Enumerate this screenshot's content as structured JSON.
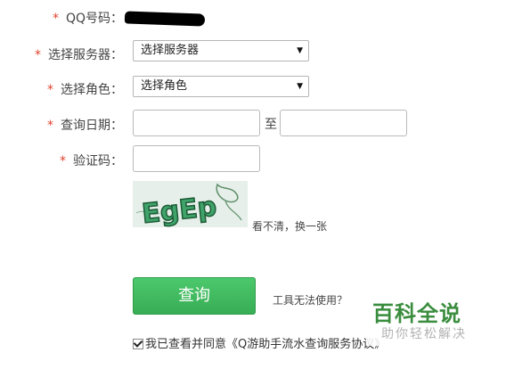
{
  "form": {
    "qq_label": "QQ号码：",
    "server_label": "选择服务器：",
    "server_value": "选择服务器",
    "role_label": "选择角色：",
    "role_value": "选择角色",
    "date_label": "查询日期：",
    "date_separator": "至",
    "date_start_value": "",
    "date_end_value": "",
    "captcha_label": "验证码：",
    "captcha_value": "",
    "captcha_image_text": "EgEp",
    "captcha_refresh": "看不清，换一张",
    "required_mark": "*"
  },
  "actions": {
    "query_button": "查询",
    "tool_help": "工具无法使用？"
  },
  "agreement": {
    "text": "我已查看并同意《Q游助手流水查询服务协议》"
  },
  "watermark": {
    "main": "百科全说",
    "sub": "助你轻松解决"
  },
  "colors": {
    "required_star": "#e0442e",
    "query_button": "#3fb65c",
    "watermark": "#3a8d3e"
  }
}
